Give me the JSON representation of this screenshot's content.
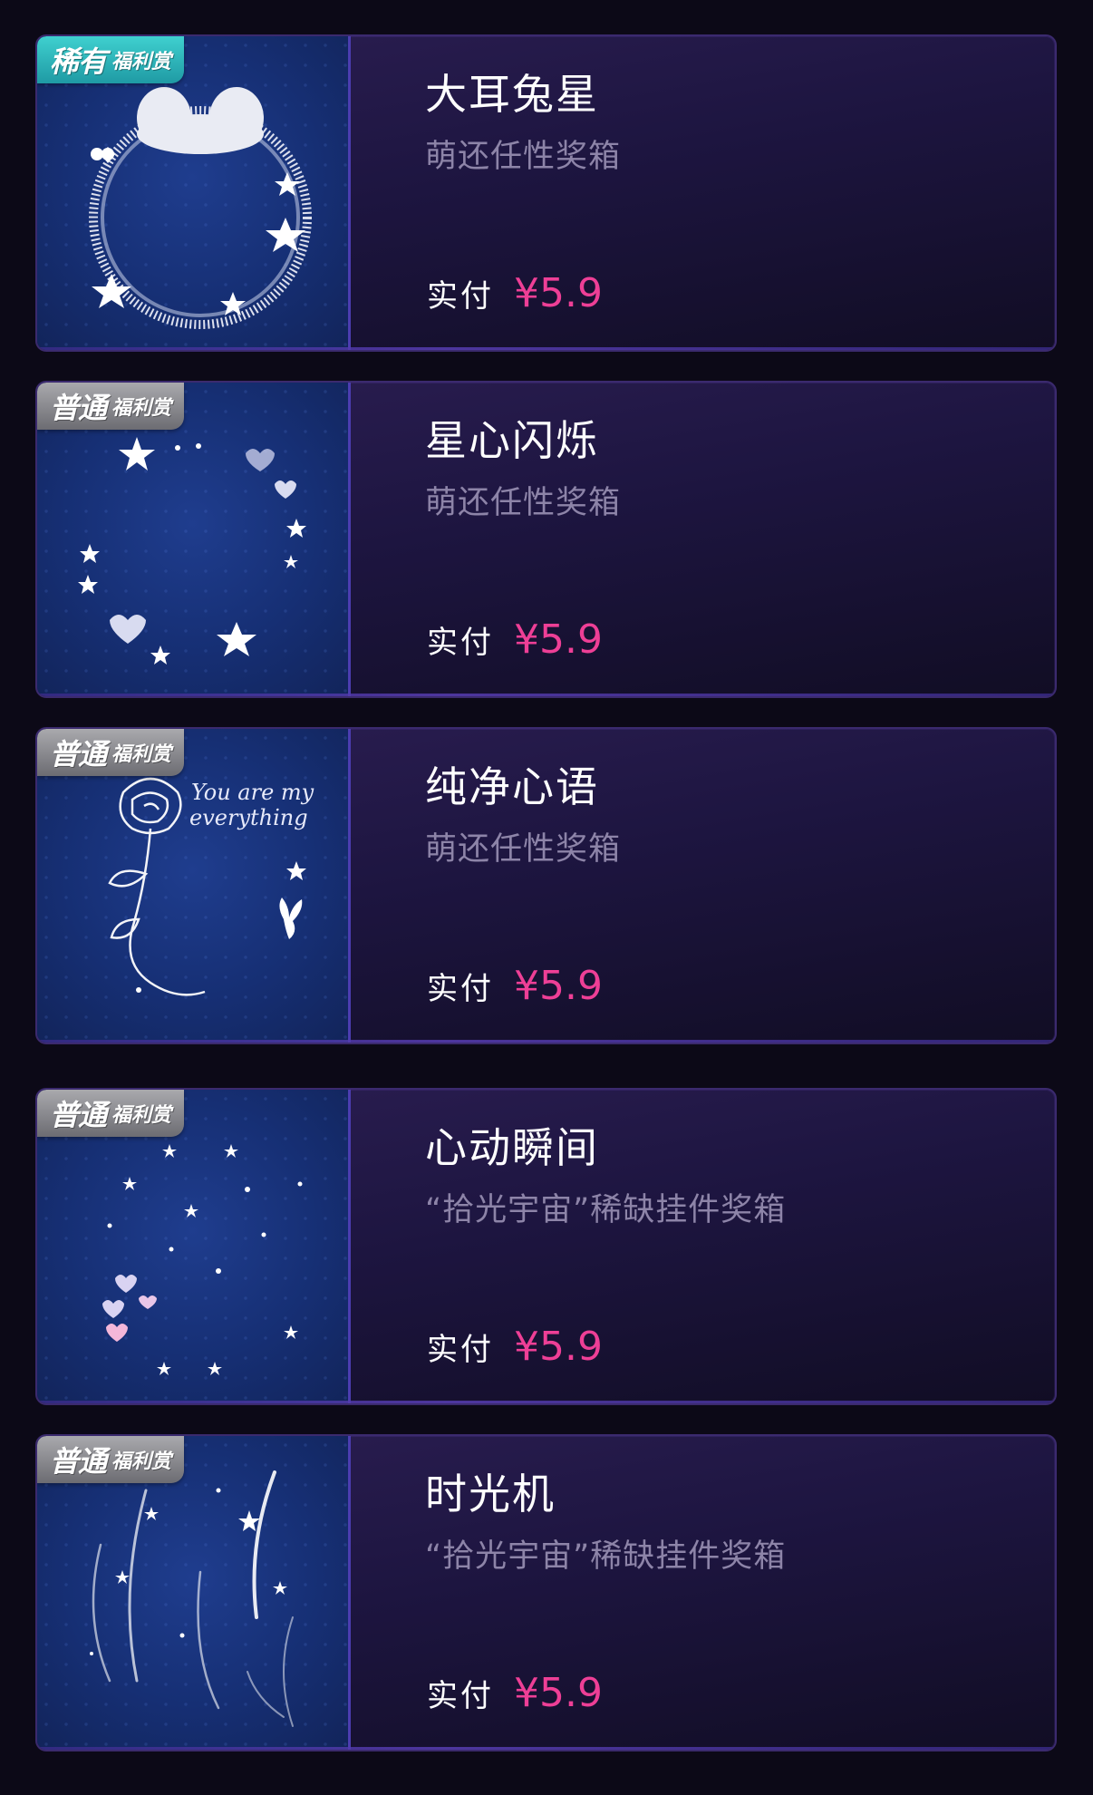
{
  "cards": [
    {
      "badge_main": "稀有",
      "badge_sub": "福利赏",
      "badge_type": "rare",
      "name": "大耳兔星",
      "subtitle": "萌还任性奖箱",
      "pay_label": "实付",
      "price": "¥5.9",
      "art": "bunny-ring-frame"
    },
    {
      "badge_main": "普通",
      "badge_sub": "福利赏",
      "badge_type": "normal",
      "name": "星心闪烁",
      "subtitle": "萌还任性奖箱",
      "pay_label": "实付",
      "price": "¥5.9",
      "art": "star-heart-ring"
    },
    {
      "badge_main": "普通",
      "badge_sub": "福利赏",
      "badge_type": "normal",
      "name": "纯净心语",
      "subtitle": "萌还任性奖箱",
      "pay_label": "实付",
      "price": "¥5.9",
      "art": "rose-you-are-my-everything",
      "art_text_line1": "You are my",
      "art_text_line2": "everything"
    },
    {
      "badge_main": "普通",
      "badge_sub": "福利赏",
      "badge_type": "normal",
      "name": "心动瞬间",
      "subtitle": "“拾光宇宙”稀缺挂件奖箱",
      "pay_label": "实付",
      "price": "¥5.9",
      "art": "scattered-stars-hearts"
    },
    {
      "badge_main": "普通",
      "badge_sub": "福利赏",
      "badge_type": "normal",
      "name": "时光机",
      "subtitle": "“拾光宇宙”稀缺挂件奖箱",
      "pay_label": "实付",
      "price": "¥5.9",
      "art": "light-streaks"
    }
  ],
  "colors": {
    "background": "#0c0917",
    "price": "#ee3f96",
    "badge_rare": "#2fb6bb",
    "badge_normal": "#8a8a90",
    "subtitle": "#8d84a8"
  }
}
